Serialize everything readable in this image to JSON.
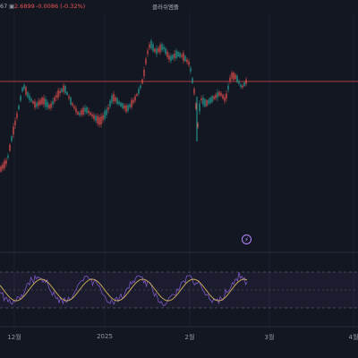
{
  "header": {
    "name_fragment": "클러쉬엠플",
    "price_fragment": "67",
    "price_current": "2.6899",
    "change": "-0.0086 (-0.32%)",
    "marker_glyph": "▣"
  },
  "time_axis": {
    "labels": [
      "12월",
      "2025",
      "2월",
      "3월",
      "4월"
    ]
  },
  "colors": {
    "background": "#131722",
    "up": "#26a69a",
    "down": "#ef5350",
    "price_line": "#e5484d",
    "indicator": "#7e57c2",
    "indicator_signal": "#d4b35a",
    "text": "#9598a1"
  },
  "icons": {
    "alert": "lightning-bolt-icon"
  }
}
